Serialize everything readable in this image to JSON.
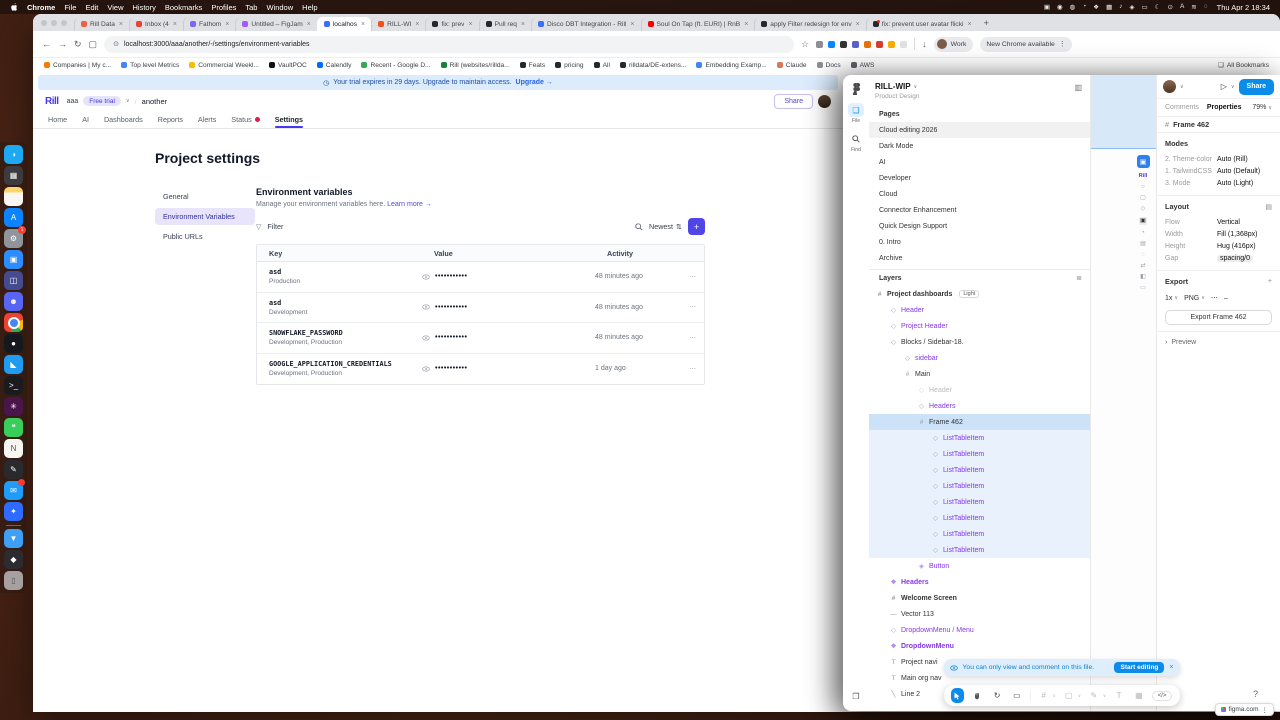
{
  "icons": {
    "back": "←",
    "forward": "→",
    "reload": "↻",
    "panel": "▢",
    "secure": "⊙",
    "star": "☆",
    "download": "↓",
    "menu_dots": "⋮",
    "more": "⋯",
    "close": "×",
    "caret": "∨",
    "plus": "+",
    "sort": "⇅",
    "play": "▷",
    "chevron_right": "›",
    "funnel": "▽",
    "layers_list": "≣",
    "grid": "▤",
    "frame": "#",
    "rotate": "↻",
    "measure": "▭",
    "shape": "▢",
    "pen": "✎",
    "text": "T",
    "actions": "▦",
    "dev": "</>",
    "folder": "❏",
    "book": "❒",
    "toggle": "▥",
    "clockish": "◷"
  },
  "menu_bar": {
    "app_name": "Chrome",
    "items": [
      "File",
      "Edit",
      "View",
      "History",
      "Bookmarks",
      "Profiles",
      "Tab",
      "Window",
      "Help"
    ],
    "status_icons": [
      "▣",
      "◉",
      "◍",
      "◔",
      "❖",
      "▦",
      "♪",
      "◈",
      "▭",
      "☾",
      "⊙",
      "A",
      "≋",
      "◌"
    ],
    "clock": "Thu Apr 2 18:34"
  },
  "chrome": {
    "tabs": [
      {
        "label": "Rill Data",
        "color": "#f06048"
      },
      {
        "label": "Inbox (4",
        "color": "#ea4335"
      },
      {
        "label": "Fathom",
        "color": "#7b68ee"
      },
      {
        "label": "Untitled – FigJam",
        "color": "#a259ff"
      },
      {
        "label": "localhos",
        "color": "#3b6ff5",
        "cls": "active"
      },
      {
        "label": "RILL-WI",
        "color": "#f24e1e"
      },
      {
        "label": "fix: prev",
        "color": "#24292f"
      },
      {
        "label": "Pull req",
        "color": "#24292f"
      },
      {
        "label": "Disco DBT Integration - Rill",
        "color": "#3b6ff5"
      },
      {
        "label": "Soul On Tap (ft. EURI) | RnB",
        "color": "#ff0000"
      },
      {
        "label": "apply Filter redesign for env",
        "color": "#24292f"
      },
      {
        "label": "fix: prevent user avatar flicki",
        "color": "#24292f",
        "cls": "dot"
      }
    ],
    "omnibox_url": "localhost:3000/aaa/another/-/settings/environment-variables",
    "extensions": [
      {
        "color": "#8e8e93"
      },
      {
        "color": "#0a84ff"
      },
      {
        "color": "#333333"
      },
      {
        "color": "#5b5fc7"
      },
      {
        "color": "#e8710a"
      },
      {
        "color": "#d23f31"
      },
      {
        "color": "#f9ab00"
      },
      {
        "color": "#e0e0e0"
      }
    ],
    "profile_label": "Work",
    "update_label": "New Chrome available",
    "bookmarks": [
      {
        "label": "Companies | My c...",
        "color": "#f57c00"
      },
      {
        "label": "Top level Metrics",
        "color": "#4285f4"
      },
      {
        "label": "Commercial Weekl...",
        "color": "#fbbc04"
      },
      {
        "label": "VaultPOC",
        "color": "#111111"
      },
      {
        "label": "Calendly",
        "color": "#006bff"
      },
      {
        "label": "Recent - Google D...",
        "color": "#34a853"
      },
      {
        "label": "Rill (websites/rillda...",
        "color": "#188038"
      },
      {
        "label": "Feats",
        "color": "#24292f"
      },
      {
        "label": "pricing",
        "color": "#24292f"
      },
      {
        "label": "All",
        "color": "#24292f"
      },
      {
        "label": "rilldata/DE-extens...",
        "color": "#24292f"
      },
      {
        "label": "Embedding Examp...",
        "color": "#4285f4"
      },
      {
        "label": "Claude",
        "color": "#d97757"
      },
      {
        "label": "Docs",
        "color": "#8a8f98"
      },
      {
        "label": "AWS",
        "color": "#5f6368"
      }
    ],
    "all_bookmarks": "All Bookmarks"
  },
  "rill": {
    "banner": {
      "text": "Your trial expires in 29 days. Upgrade to maintain access.",
      "link": "Upgrade →"
    },
    "header": {
      "logo": "Rill",
      "org": "aaa",
      "trial_badge": "Free trial",
      "separator": "/",
      "project": "another",
      "share": "Share"
    },
    "nav": [
      {
        "label": "Home"
      },
      {
        "label": "AI"
      },
      {
        "label": "Dashboards"
      },
      {
        "label": "Reports"
      },
      {
        "label": "Alerts"
      },
      {
        "label": "Status",
        "cls": "alert"
      },
      {
        "label": "Settings",
        "cls": "active"
      }
    ],
    "page_title": "Project settings",
    "settings_nav": [
      {
        "label": "General"
      },
      {
        "label": "Environment Variables",
        "cls": "active"
      },
      {
        "label": "Public URLs"
      }
    ],
    "section": {
      "title": "Environment variables",
      "description": "Manage your environment variables here.",
      "link": "Learn more →"
    },
    "toolbar": {
      "filter": "Filter",
      "sort": "Newest"
    },
    "table": {
      "columns": [
        "Key",
        "Value",
        "Activity"
      ],
      "rows": [
        {
          "key": "asd",
          "envs": "Production",
          "value": "•••••••••••",
          "activity": "48 minutes ago"
        },
        {
          "key": "asd",
          "envs": "Development",
          "value": "•••••••••••",
          "activity": "48 minutes ago"
        },
        {
          "key": "SNOWFLAKE_PASSWORD",
          "envs": "Development, Production",
          "value": "•••••••••••",
          "activity": "48 minutes ago"
        },
        {
          "key": "GOOGLE_APPLICATION_CREDENTIALS",
          "envs": "Development, Production",
          "value": "•••••••••••",
          "activity": "1 day ago"
        }
      ]
    }
  },
  "figma": {
    "file_name": "RILL-WIP",
    "team": "Product Design",
    "rail": {
      "file_label": "File",
      "find_label": "Find"
    },
    "pages_label": "Pages",
    "pages": [
      {
        "label": "Cloud editing 2026",
        "cls": "active"
      },
      {
        "label": "Dark Mode"
      },
      {
        "label": "AI"
      },
      {
        "label": "Developer"
      },
      {
        "label": "Cloud"
      },
      {
        "label": "Connector Enhancement"
      },
      {
        "label": "Quick Design Support"
      },
      {
        "label": "0. Intro"
      },
      {
        "label": "Archive"
      }
    ],
    "layers_label": "Layers",
    "layers": [
      {
        "name": "Project dashboards",
        "icon": "#",
        "cls": "dark bold",
        "indent": 6,
        "badge": "Light"
      },
      {
        "name": "Header",
        "icon": "◇",
        "cls": "purple",
        "indent": 20
      },
      {
        "name": "Project Header",
        "icon": "◇",
        "cls": "purple",
        "indent": 20
      },
      {
        "name": "Blocks / Sidebar-18.",
        "icon": "◇",
        "cls": "dark",
        "indent": 20
      },
      {
        "name": "sidebar",
        "icon": "◇",
        "cls": "purple",
        "indent": 34
      },
      {
        "name": "Main",
        "icon": "#",
        "cls": "dark",
        "indent": 34
      },
      {
        "name": "Header",
        "icon": "◇",
        "cls": "dim",
        "indent": 48
      },
      {
        "name": "Headers",
        "icon": "◇",
        "cls": "purple",
        "indent": 48
      },
      {
        "name": "Frame 462",
        "icon": "#",
        "cls": "dark selected",
        "indent": 48
      },
      {
        "name": "ListTableItem",
        "icon": "◇",
        "cls": "purple tint",
        "indent": 62
      },
      {
        "name": "ListTableItem",
        "icon": "◇",
        "cls": "purple tint",
        "indent": 62
      },
      {
        "name": "ListTableItem",
        "icon": "◇",
        "cls": "purple tint",
        "indent": 62
      },
      {
        "name": "ListTableItem",
        "icon": "◇",
        "cls": "purple tint",
        "indent": 62
      },
      {
        "name": "ListTableItem",
        "icon": "◇",
        "cls": "purple tint",
        "indent": 62
      },
      {
        "name": "ListTableItem",
        "icon": "◇",
        "cls": "purple tint",
        "indent": 62
      },
      {
        "name": "ListTableItem",
        "icon": "◇",
        "cls": "purple tint",
        "indent": 62
      },
      {
        "name": "ListTableItem",
        "icon": "◇",
        "cls": "purple tint",
        "indent": 62
      },
      {
        "name": "Button",
        "icon": "◈",
        "cls": "purple",
        "indent": 48
      },
      {
        "name": "Headers",
        "icon": "❖",
        "cls": "purple bold",
        "indent": 20
      },
      {
        "name": "Welcome Screen",
        "icon": "#",
        "cls": "dark bold",
        "indent": 20
      },
      {
        "name": "Vector 113",
        "icon": "—",
        "cls": "dark",
        "indent": 20
      },
      {
        "name": "DropdownMenu / Menu",
        "icon": "◇",
        "cls": "purple",
        "indent": 20
      },
      {
        "name": "DropdownMenu",
        "icon": "❖",
        "cls": "purple bold",
        "indent": 20
      },
      {
        "name": "Project navi",
        "icon": "T",
        "cls": "dark",
        "indent": 20
      },
      {
        "name": "Main org nav",
        "icon": "T",
        "cls": "dark",
        "indent": 20
      },
      {
        "name": "Line 2",
        "icon": "╲",
        "cls": "dark",
        "indent": 20
      }
    ],
    "topbar": {
      "share": "Share"
    },
    "tabs": {
      "comments": "Comments",
      "properties": "Properties",
      "zoom": "79%"
    },
    "selection": {
      "name": "Frame 462"
    },
    "modes": {
      "title": "Modes",
      "rows": [
        {
          "k": "2. Theme-color",
          "v": "Auto (Rill)"
        },
        {
          "k": "1. TailwindCSS",
          "v": "Auto (Default)"
        },
        {
          "k": "3. Mode",
          "v": "Auto (Light)"
        }
      ]
    },
    "layout": {
      "title": "Layout",
      "rows": [
        {
          "k": "Flow",
          "v": "Vertical"
        },
        {
          "k": "Width",
          "v": "Fill (1,368px)"
        },
        {
          "k": "Height",
          "v": "Hug (416px)"
        }
      ],
      "gap_label": "Gap",
      "gap_value": "spacing/0"
    },
    "export": {
      "title": "Export",
      "scale": "1x",
      "format": "PNG",
      "remove": "–",
      "button": "Export Frame 462"
    },
    "preview_label": "Preview",
    "toast": {
      "text": "You can only view and comment on this file.",
      "button": "Start editing"
    },
    "help": "?",
    "site_badge": "figma.com",
    "canvas_logo": "Rill",
    "canvas_icons": [
      {
        "g": "○"
      },
      {
        "g": "▢"
      },
      {
        "g": "◇"
      },
      {
        "g": "▣",
        "cls": "on"
      },
      {
        "g": "◔"
      },
      {
        "g": "▤"
      },
      {
        "g": "◌"
      },
      {
        "g": "⇄"
      },
      {
        "g": "◧"
      },
      {
        "g": "▭"
      }
    ]
  },
  "dock": {
    "items": [
      {
        "name": "finder",
        "color": "#1ea7f2",
        "glyph": "◑"
      },
      {
        "name": "launchpad",
        "color": "#3c3c40",
        "glyph": "▦"
      },
      {
        "name": "notes",
        "glyph": "",
        "cls": "notes"
      },
      {
        "name": "app-store",
        "color": "#0d84ff",
        "glyph": "A"
      },
      {
        "name": "system-settings",
        "color": "#90949b",
        "glyph": "⚙",
        "badge": "1"
      },
      {
        "name": "zoom",
        "color": "#2d8cff",
        "glyph": "▣"
      },
      {
        "name": "collaboration-app",
        "color": "#464a8f",
        "glyph": "◫"
      },
      {
        "name": "discord",
        "color": "#5865f2",
        "glyph": "☻"
      },
      {
        "name": "chrome",
        "glyph": "",
        "cls": "chrome"
      },
      {
        "name": "github",
        "color": "#15191e",
        "glyph": "●"
      },
      {
        "name": "vscode",
        "color": "#1f9cf0",
        "glyph": "◣"
      },
      {
        "name": "terminal",
        "color": "#1b1b1f",
        "glyph": ">_"
      },
      {
        "name": "slack",
        "color": "#4a154b",
        "glyph": "✳"
      },
      {
        "name": "messages",
        "color": "#39ce5a",
        "glyph": "❝"
      },
      {
        "name": "notion",
        "color": "#f7f6f3",
        "glyph": "N",
        "cls": "lighticon"
      },
      {
        "name": "design-app",
        "color": "#2a2a2e",
        "glyph": "✎"
      },
      {
        "name": "mail",
        "color": "#1f9cf7",
        "glyph": "✉",
        "cls": "notif"
      },
      {
        "name": "pointer-app",
        "color": "#2f6bff",
        "glyph": "✦"
      },
      {
        "name": "downloads-folder",
        "color": "#3f9ff5",
        "glyph": "▼",
        "cls": "sep"
      },
      {
        "name": "utility-app",
        "color": "#2c2c30",
        "glyph": "◆"
      },
      {
        "name": "trash",
        "color": "rgba(205,205,210,0.75)",
        "glyph": "▯",
        "cls": "lighticon"
      }
    ]
  }
}
